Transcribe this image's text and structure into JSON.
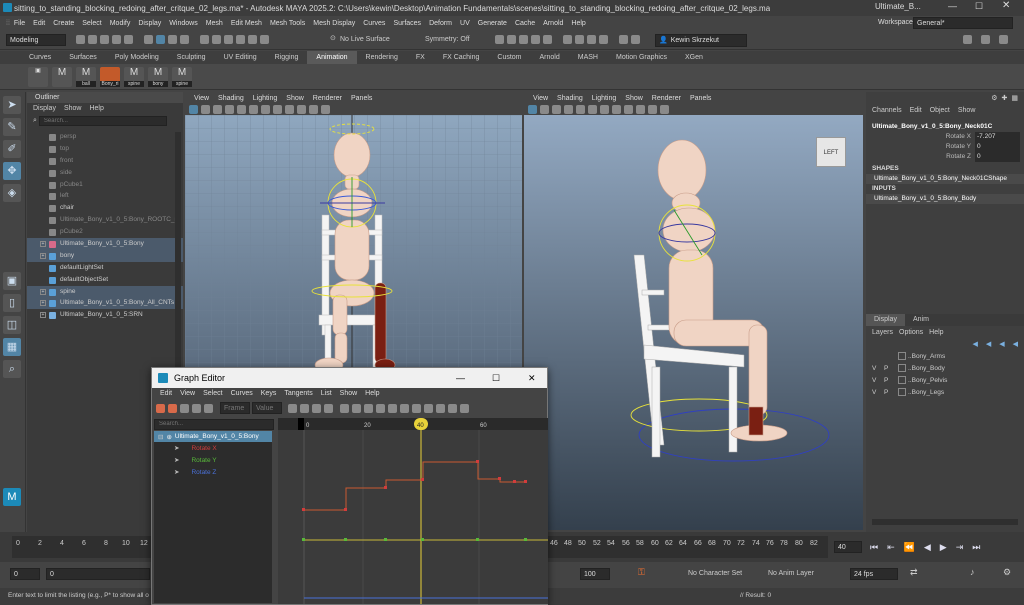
{
  "window": {
    "title": "sitting_to_standing_blocking_redoing_after_critque_02_legs.ma* - Autodesk MAYA 2025.2: C:\\Users\\kewin\\Desktop\\Animation Fundamentals\\scenes\\sitting_to_standing_blocking_redoing_after_critque_02_legs.ma",
    "search_text": "Ultimate_B..."
  },
  "menu": [
    "File",
    "Edit",
    "Create",
    "Select",
    "Modify",
    "Display",
    "Windows",
    "Mesh",
    "Edit Mesh",
    "Mesh Tools",
    "Mesh Display",
    "Curves",
    "Surfaces",
    "Deform",
    "UV",
    "Generate",
    "Cache",
    "Arnold",
    "Help"
  ],
  "workspace": {
    "label": "Workspace:",
    "value": "General*"
  },
  "status": {
    "mode": "Modeling",
    "live_surface": "No Live Surface",
    "symmetry": "Symmetry: Off",
    "user": "Kewin Skrzekut"
  },
  "shelf_tabs": [
    "Curves",
    "Surfaces",
    "Poly Modeling",
    "Sculpting",
    "UV Editing",
    "Rigging",
    "Animation",
    "Rendering",
    "FX",
    "FX Caching",
    "Custom",
    "Arnold",
    "MASH",
    "Motion Graphics",
    "XGen"
  ],
  "shelf_active": "Animation",
  "shelf_buttons": [
    "ball",
    "Bony_ri",
    "spine",
    "bony",
    "spine"
  ],
  "outliner": {
    "title": "Outliner",
    "menu": [
      "Display",
      "Show",
      "Help"
    ],
    "search_placeholder": "Search...",
    "items": [
      {
        "label": "persp",
        "dim": true
      },
      {
        "label": "top",
        "dim": true
      },
      {
        "label": "front",
        "dim": true
      },
      {
        "label": "side",
        "dim": true
      },
      {
        "label": "pCube1",
        "dim": true
      },
      {
        "label": "left",
        "dim": true
      },
      {
        "label": "chair",
        "dim": false
      },
      {
        "label": "Ultimate_Bony_v1_0_5:Bony_ROOTC_m",
        "dim": true
      },
      {
        "label": "pCube2",
        "dim": true
      },
      {
        "label": "Ultimate_Bony_v1_0_5:Bony",
        "dim": false,
        "hl": true
      },
      {
        "label": "bony",
        "dim": false,
        "hl": true
      },
      {
        "label": "defaultLightSet",
        "dim": false
      },
      {
        "label": "defaultObjectSet",
        "dim": false
      },
      {
        "label": "spine",
        "dim": false,
        "hl": true
      },
      {
        "label": "Ultimate_Bony_v1_0_5:Bony_All_CNTs",
        "dim": false,
        "hl": true
      },
      {
        "label": "Ultimate_Bony_v1_0_5:SRN",
        "dim": false
      }
    ]
  },
  "viewport_menu": [
    "View",
    "Shading",
    "Lighting",
    "Show",
    "Renderer",
    "Panels"
  ],
  "viewcube_label": "LEFT",
  "channel_box": {
    "menu": [
      "Channels",
      "Edit",
      "Object",
      "Show"
    ],
    "node": "Ultimate_Bony_v1_0_5:Bony_Neck01C",
    "attrs": [
      {
        "name": "Rotate X",
        "value": "-7.207"
      },
      {
        "name": "Rotate Y",
        "value": "0"
      },
      {
        "name": "Rotate Z",
        "value": "0"
      }
    ],
    "shapes_label": "SHAPES",
    "shape": "Ultimate_Bony_v1_0_5:Bony_Neck01CShape",
    "inputs_label": "INPUTS",
    "input": "Ultimate_Bony_v1_0_5:Bony_Body"
  },
  "layers": {
    "tabs": [
      "Display",
      "Anim"
    ],
    "menu": [
      "Layers",
      "Options",
      "Help"
    ],
    "items": [
      {
        "v": "",
        "p": "",
        "name": "..Bony_Arms"
      },
      {
        "v": "V",
        "p": "P",
        "name": "..Bony_Body"
      },
      {
        "v": "V",
        "p": "P",
        "name": "..Bony_Pelvis"
      },
      {
        "v": "V",
        "p": "P",
        "name": "..Bony_Legs"
      }
    ]
  },
  "timeline": {
    "ticks_left": [
      "0",
      "2",
      "4",
      "6",
      "8",
      "10",
      "12"
    ],
    "ticks_right": [
      "46",
      "48",
      "50",
      "52",
      "54",
      "56",
      "58",
      "60",
      "62",
      "64",
      "66",
      "68",
      "70",
      "72",
      "74",
      "76",
      "78",
      "80",
      "82"
    ],
    "current_frame": "40",
    "range_start": "0",
    "range_start2": "0",
    "range_end": "100",
    "character_set": "No Character Set",
    "anim_layer": "No Anim Layer",
    "fps": "24 fps"
  },
  "help_line": "Enter text to limit the listing (e.g., P* to show all o",
  "result_line": "// Result: 0",
  "graph_editor": {
    "title": "Graph Editor",
    "menu": [
      "Edit",
      "View",
      "Select",
      "Curves",
      "Keys",
      "Tangents",
      "List",
      "Show",
      "Help"
    ],
    "frame_label": "Frame",
    "value_label": "Value",
    "search_placeholder": "Search...",
    "node": "Ultimate_Bony_v1_0_5:Bony",
    "curves": [
      {
        "label": "Rotate X",
        "color": "#d23c3c"
      },
      {
        "label": "Rotate Y",
        "color": "#58b83a"
      },
      {
        "label": "Rotate Z",
        "color": "#4a70d8"
      }
    ],
    "ruler": [
      "0",
      "20",
      "40",
      "60"
    ],
    "current_frame": "40"
  },
  "colors": {
    "accent": "#5285a6",
    "maya_blue": "#3a7bd5"
  }
}
